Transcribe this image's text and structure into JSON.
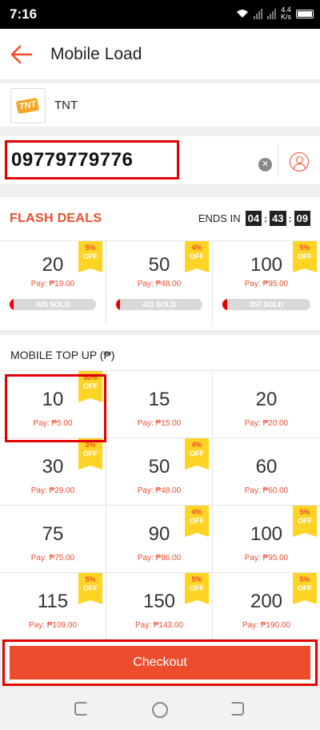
{
  "status_bar": {
    "time": "7:16",
    "speed_top": "4.4",
    "speed_unit": "K/s"
  },
  "app_bar": {
    "title": "Mobile Load"
  },
  "provider": {
    "name": "TNT",
    "logo_text": "TNT"
  },
  "phone": {
    "number": "09779779776"
  },
  "flash_deals": {
    "title": "FLASH DEALS",
    "ends_label": "ENDS IN",
    "hours": "04",
    "minutes": "43",
    "seconds": "09",
    "items": [
      {
        "amount": "20",
        "pay": "Pay: ₱19.00",
        "badge_pct": "5%",
        "badge_off": "OFF",
        "sold": "325 SOLD",
        "sold_fraction": 0.05
      },
      {
        "amount": "50",
        "pay": "Pay: ₱48.00",
        "badge_pct": "4%",
        "badge_off": "OFF",
        "sold": "411 SOLD",
        "sold_fraction": 0.05
      },
      {
        "amount": "100",
        "pay": "Pay: ₱95.00",
        "badge_pct": "5%",
        "badge_off": "OFF",
        "sold": "357 SOLD",
        "sold_fraction": 0.05
      }
    ]
  },
  "mobile_topup": {
    "title": "MOBILE TOP UP (₱)",
    "items": [
      {
        "amount": "10",
        "pay": "Pay: ₱5.00",
        "badge_pct": "50%",
        "badge_off": "OFF"
      },
      {
        "amount": "15",
        "pay": "Pay: ₱15.00"
      },
      {
        "amount": "20",
        "pay": "Pay: ₱20.00"
      },
      {
        "amount": "30",
        "pay": "Pay: ₱29.00",
        "badge_pct": "3%",
        "badge_off": "OFF"
      },
      {
        "amount": "50",
        "pay": "Pay: ₱48.00",
        "badge_pct": "4%",
        "badge_off": "OFF"
      },
      {
        "amount": "60",
        "pay": "Pay: ₱60.00"
      },
      {
        "amount": "75",
        "pay": "Pay: ₱75.00"
      },
      {
        "amount": "90",
        "pay": "Pay: ₱86.00",
        "badge_pct": "4%",
        "badge_off": "OFF"
      },
      {
        "amount": "100",
        "pay": "Pay: ₱95.00",
        "badge_pct": "5%",
        "badge_off": "OFF"
      },
      {
        "amount": "115",
        "pay": "Pay: ₱109.00",
        "badge_pct": "5%",
        "badge_off": "OFF"
      },
      {
        "amount": "150",
        "pay": "Pay: ₱143.00",
        "badge_pct": "5%",
        "badge_off": "OFF"
      },
      {
        "amount": "200",
        "pay": "Pay: ₱190.00",
        "badge_pct": "5%",
        "badge_off": "OFF"
      }
    ]
  },
  "checkout": {
    "label": "Checkout"
  },
  "colors": {
    "accent": "#ee4d2d",
    "highlight": "#e30000",
    "badge": "#ffd424"
  }
}
